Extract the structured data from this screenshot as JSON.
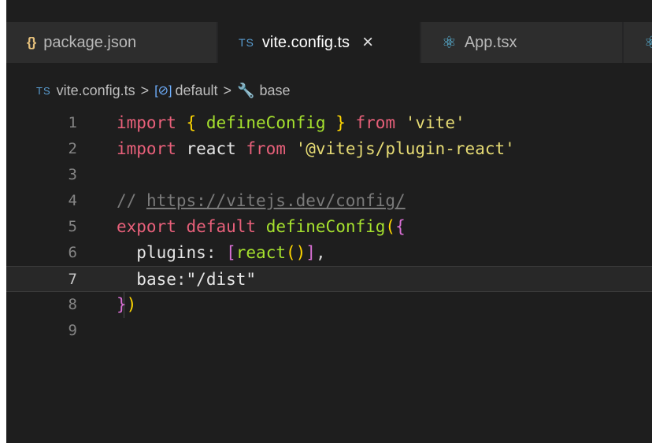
{
  "tabs": [
    {
      "icon": "{}",
      "label": "package.json"
    },
    {
      "icon": "TS",
      "label": "vite.config.ts",
      "close": "×"
    },
    {
      "icon": "⚛",
      "label": "App.tsx"
    },
    {
      "icon": "⚛",
      "label": ""
    }
  ],
  "breadcrumb": {
    "file_icon": "TS",
    "file": "vite.config.ts",
    "separator": ">",
    "symbol_icon": "[⊘]",
    "symbol": "default",
    "prop_icon": "🔧",
    "property": "base"
  },
  "lines": [
    {
      "number": "1",
      "tokens": [
        "import",
        " ",
        "{",
        " ",
        "defineConfig",
        " ",
        "}",
        " ",
        "from",
        " ",
        "'vite'"
      ]
    },
    {
      "number": "2",
      "tokens": [
        "import",
        " ",
        "react",
        " ",
        "from",
        " ",
        "'@vitejs/plugin-react'"
      ]
    },
    {
      "number": "3",
      "tokens": []
    },
    {
      "number": "4",
      "tokens": [
        "// ",
        "https://vitejs.dev/config/"
      ]
    },
    {
      "number": "5",
      "tokens": [
        "export",
        " ",
        "default",
        " ",
        "defineConfig",
        "(",
        "{"
      ]
    },
    {
      "number": "6",
      "tokens": [
        "  ",
        "plugins",
        ": ",
        "[",
        "react",
        "()",
        "]",
        ","
      ]
    },
    {
      "number": "7",
      "tokens": [
        "  ",
        "base",
        ":",
        "\"/dist\""
      ]
    },
    {
      "number": "8",
      "tokens": [
        "}",
        ")"
      ]
    },
    {
      "number": "9",
      "tokens": []
    }
  ],
  "colors": {
    "keyword": "#e8607a",
    "function": "#a6e22e",
    "string": "#e6db74",
    "bracket_level1": "#ffd700",
    "bracket_level2": "#da70d6",
    "comment": "#7a7a7a",
    "editor_background": "#1e1e1e"
  }
}
